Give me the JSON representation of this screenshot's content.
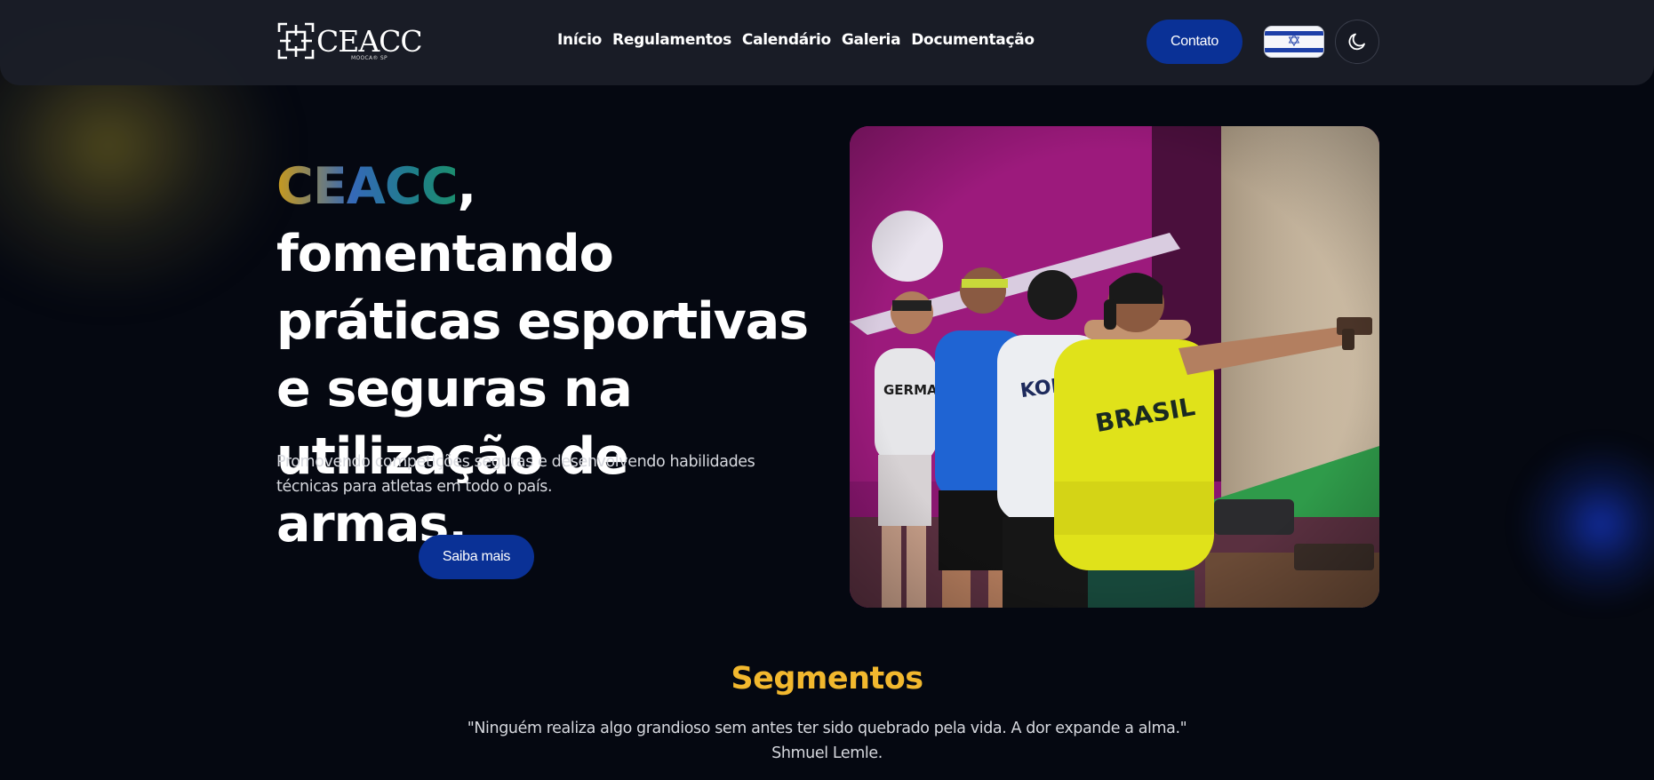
{
  "header": {
    "logo": {
      "text": "CEACC",
      "sub": "MOOCA® SP"
    },
    "nav": [
      {
        "label": "Início"
      },
      {
        "label": "Regulamentos"
      },
      {
        "label": "Calendário"
      },
      {
        "label": "Galeria"
      },
      {
        "label": "Documentação"
      }
    ],
    "contact_label": "Contato",
    "flag_icon": "israel-flag-icon",
    "theme_icon": "moon-icon"
  },
  "hero": {
    "title_highlight": "CEACC",
    "title_rest": ", fomentando práticas esportivas e seguras na utilização de armas.",
    "subtitle": "Promovendo competições seguras e desenvolvendo habilidades técnicas para atletas em todo o país.",
    "cta_label": "Saiba mais",
    "image": {
      "description_icon": "shooting-competition-photo",
      "shirt_texts": [
        "GERMAN",
        "KOREA",
        "BRASIL"
      ]
    }
  },
  "segments": {
    "title": "Segmentos",
    "quote": "\"Ninguém realiza algo grandioso sem antes ter sido quebrado pela vida. A dor expande a alma.\"",
    "author": "Shmuel Lemle."
  },
  "colors": {
    "background": "#050811",
    "header": "#1b1e28",
    "primary_button": "#0a3196",
    "accent_yellow": "#f2b82e"
  }
}
